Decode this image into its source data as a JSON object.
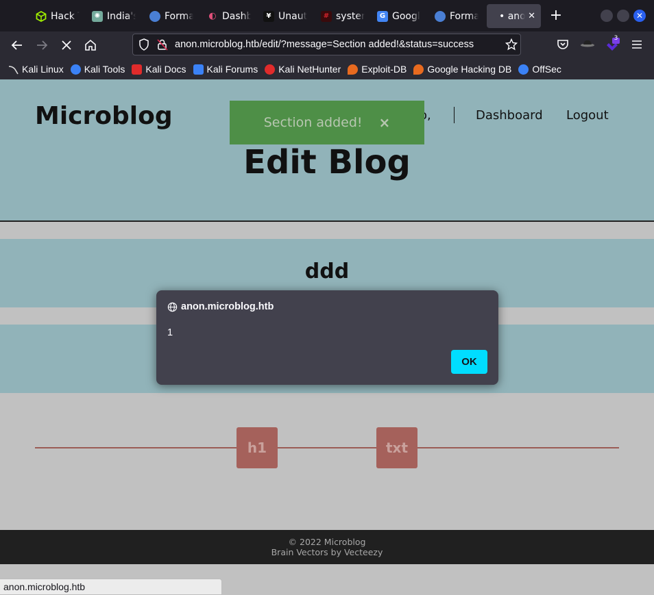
{
  "browser": {
    "tabs": [
      {
        "label": "Hack T",
        "icon": "hackthebox-icon",
        "color": "#9fef00"
      },
      {
        "label": "India's",
        "icon": "chatgpt-icon",
        "color": "#74aa9c"
      },
      {
        "label": "Forma",
        "icon": "kali-tools-icon",
        "color": "#4a7fd4"
      },
      {
        "label": "Dashb",
        "icon": "dashboard-icon",
        "color": "#e0507a"
      },
      {
        "label": "Unaut",
        "icon": "unauthorized-icon",
        "color": "#111111"
      },
      {
        "label": "syster",
        "icon": "hash-icon",
        "color": "#d4242c"
      },
      {
        "label": "Googl",
        "icon": "google-translate-icon",
        "color": "#4285f4"
      },
      {
        "label": "Forma",
        "icon": "kali-tools-icon",
        "color": "#4a7fd4"
      },
      {
        "label": "• anon",
        "icon": "",
        "color": "",
        "active": true
      }
    ],
    "new_tab": "+",
    "url": "anon.microblog.htb/edit/?message=Section added!&status=success",
    "extension_badge": "3",
    "bookmarks": [
      {
        "label": "Kali Linux",
        "color": "#367bf0"
      },
      {
        "label": "Kali Tools",
        "color": "#3b82f6"
      },
      {
        "label": "Kali Docs",
        "color": "#e02b2b"
      },
      {
        "label": "Kali Forums",
        "color": "#3b82f6"
      },
      {
        "label": "Kali NetHunter",
        "color": "#e02b2b"
      },
      {
        "label": "Exploit-DB",
        "color": "#e86a1f"
      },
      {
        "label": "Google Hacking DB",
        "color": "#e86a1f"
      },
      {
        "label": "OffSec",
        "color": "#3b82f6"
      }
    ],
    "status_url": "anon.microblog.htb"
  },
  "site": {
    "brand": "Microblog",
    "nav_partial": "o,",
    "nav_dashboard": "Dashboard",
    "nav_logout": "Logout",
    "title": "Edit Blog",
    "toast_message": "Section added!",
    "toast_close": "×",
    "section_heading": "ddd",
    "blocks": [
      "h1",
      "txt"
    ],
    "footer_line1": "© 2022 Microblog",
    "footer_line2": "Brain Vectors by Vecteezy"
  },
  "dialog": {
    "origin": "anon.microblog.htb",
    "message": "1",
    "ok_label": "OK"
  },
  "colors": {
    "accent": "#00ddff",
    "toast": "#4e8f47",
    "hero": "#91b3b9"
  }
}
